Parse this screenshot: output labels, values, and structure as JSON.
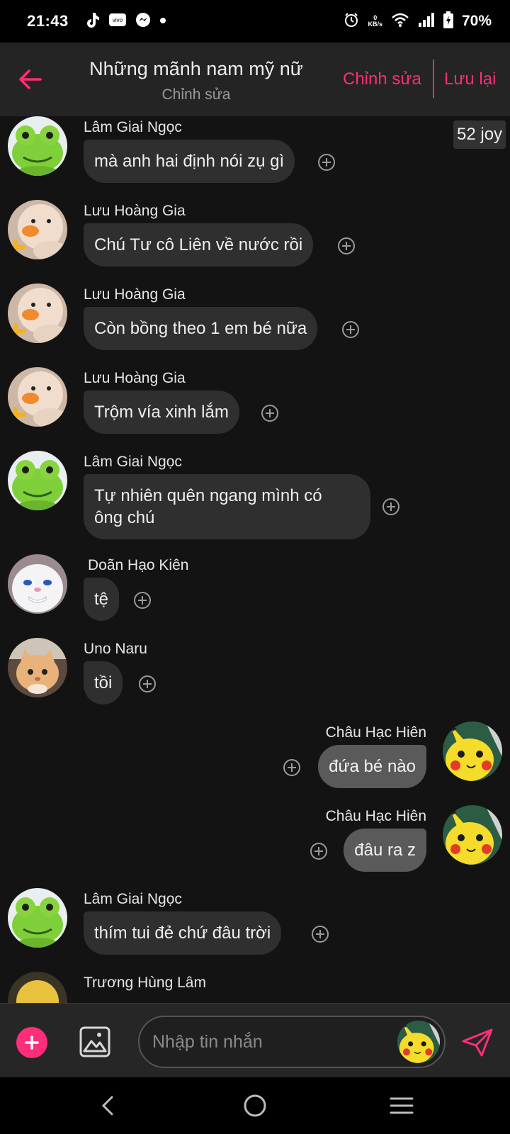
{
  "status": {
    "time": "21:43",
    "kbs_value": "0",
    "kbs_unit": "KB/s",
    "battery": "70%",
    "apps": [
      "tiktok-icon",
      "vivo-icon",
      "messenger-icon",
      "dot-icon"
    ]
  },
  "header": {
    "title": "Những mãnh nam mỹ nữ",
    "subtitle": "Chỉnh sửa",
    "edit_label": "Chỉnh sửa",
    "save_label": "Lưu lại"
  },
  "badge": "52 joy",
  "messages": [
    {
      "sender": "Lâm Giai Ngọc",
      "text": "mà anh hai định nói zụ gì",
      "side": "in",
      "avatar": "frog"
    },
    {
      "sender": "Lưu Hoàng Gia",
      "text": "Chú Tư cô Liên về nước rồi",
      "side": "in",
      "avatar": "duck"
    },
    {
      "sender": "Lưu Hoàng Gia",
      "text": "Còn bồng theo 1 em bé nữa",
      "side": "in",
      "avatar": "duck"
    },
    {
      "sender": "Lưu Hoàng Gia",
      "text": "Trộm vía xinh lắm",
      "side": "in",
      "avatar": "duck"
    },
    {
      "sender": "Lâm Giai Ngọc",
      "text_lines": [
        "Tự nhiên quên ngang mình có",
        "ông chú"
      ],
      "side": "in",
      "avatar": "frog"
    },
    {
      "sender": "Doãn Hạo Kiên",
      "text": "tệ",
      "side": "in",
      "avatar": "bunny"
    },
    {
      "sender": "Uno Naru",
      "text": "tồi",
      "side": "in",
      "avatar": "cat"
    },
    {
      "sender": "Châu Hạc Hiên",
      "text": "đứa bé nào",
      "side": "out",
      "avatar": "pikachu"
    },
    {
      "sender": "Châu Hạc Hiên",
      "text": "đâu ra z",
      "side": "out",
      "avatar": "pikachu"
    },
    {
      "sender": "Lâm Giai Ngọc",
      "text": "thím tui đẻ chứ đâu trời",
      "side": "in",
      "avatar": "frog"
    },
    {
      "sender": "Trương Hùng Lâm",
      "side": "in",
      "avatar": "yellow"
    }
  ],
  "input": {
    "placeholder": "Nhập tin nhắn"
  },
  "colors": {
    "accent": "#ff2d7a",
    "background": "#131313",
    "header": "#242424",
    "bubble_in": "#2f2f2f",
    "bubble_out": "#5a5a5a"
  }
}
